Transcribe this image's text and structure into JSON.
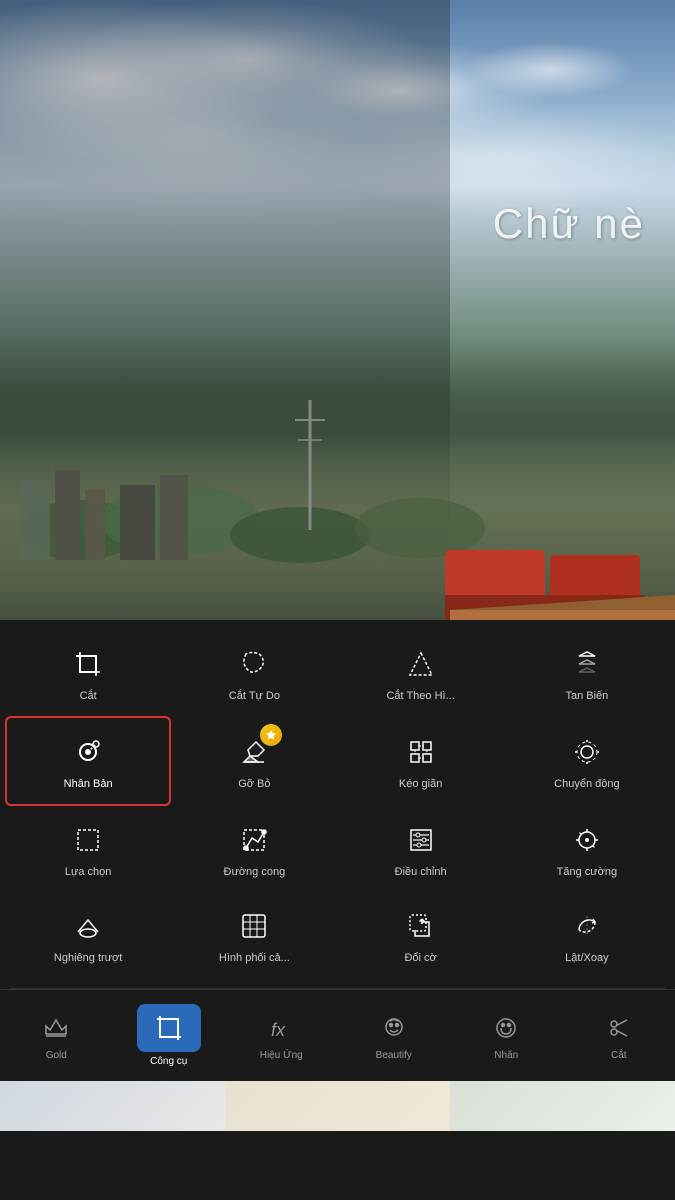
{
  "photo": {
    "overlay_text": "Chữ nè"
  },
  "tools": {
    "rows": [
      [
        {
          "id": "cat",
          "label": "Cắt",
          "icon": "crop",
          "selected": false
        },
        {
          "id": "cat-tu-do",
          "label": "Cắt Tự Do",
          "icon": "free-crop",
          "selected": false
        },
        {
          "id": "cat-theo-hinh",
          "label": "Cắt Theo Hì...",
          "icon": "shape-crop",
          "selected": false
        },
        {
          "id": "tan-bien",
          "label": "Tan Biến",
          "icon": "fade",
          "selected": false
        }
      ],
      [
        {
          "id": "nhan-ban",
          "label": "Nhân Bản",
          "icon": "duplicate",
          "selected": true
        },
        {
          "id": "go-bo",
          "label": "Gỡ Bỏ",
          "icon": "remove",
          "selected": false,
          "badge": "gold"
        },
        {
          "id": "keo-gian",
          "label": "Kéo giãn",
          "icon": "stretch",
          "selected": false
        },
        {
          "id": "chuyen-dong",
          "label": "Chuyển động",
          "icon": "motion",
          "selected": false
        }
      ],
      [
        {
          "id": "lua-chon",
          "label": "Lựa chọn",
          "icon": "select",
          "selected": false
        },
        {
          "id": "duong-cong",
          "label": "Đường cong",
          "icon": "curve",
          "selected": false
        },
        {
          "id": "dieu-chinh",
          "label": "Điều chỉnh",
          "icon": "adjust",
          "selected": false
        },
        {
          "id": "tang-cuong",
          "label": "Tăng cường",
          "icon": "enhance",
          "selected": false
        }
      ],
      [
        {
          "id": "nghieng-truot",
          "label": "Nghiêng trượt",
          "icon": "tilt",
          "selected": false
        },
        {
          "id": "hinh-phoi",
          "label": "Hình phối cả...",
          "icon": "blend",
          "selected": false
        },
        {
          "id": "doi-co",
          "label": "Đổi cờ",
          "icon": "swap",
          "selected": false
        },
        {
          "id": "lat-xoay",
          "label": "Lật/Xoay",
          "icon": "flip-rotate",
          "selected": false
        }
      ]
    ]
  },
  "bottom_tabs": [
    {
      "id": "gold",
      "label": "Gold",
      "icon": "crown",
      "active": false
    },
    {
      "id": "cong-cu",
      "label": "Công cụ",
      "icon": "crop-tool",
      "active": true
    },
    {
      "id": "hieu-ung",
      "label": "Hiệu Ứng",
      "icon": "effects",
      "active": false
    },
    {
      "id": "beautify",
      "label": "Beautify",
      "icon": "face",
      "active": false
    },
    {
      "id": "nhan",
      "label": "Nhãn",
      "icon": "sticker",
      "active": false
    },
    {
      "id": "cat-tab",
      "label": "Cắt",
      "icon": "scissors",
      "active": false
    }
  ]
}
